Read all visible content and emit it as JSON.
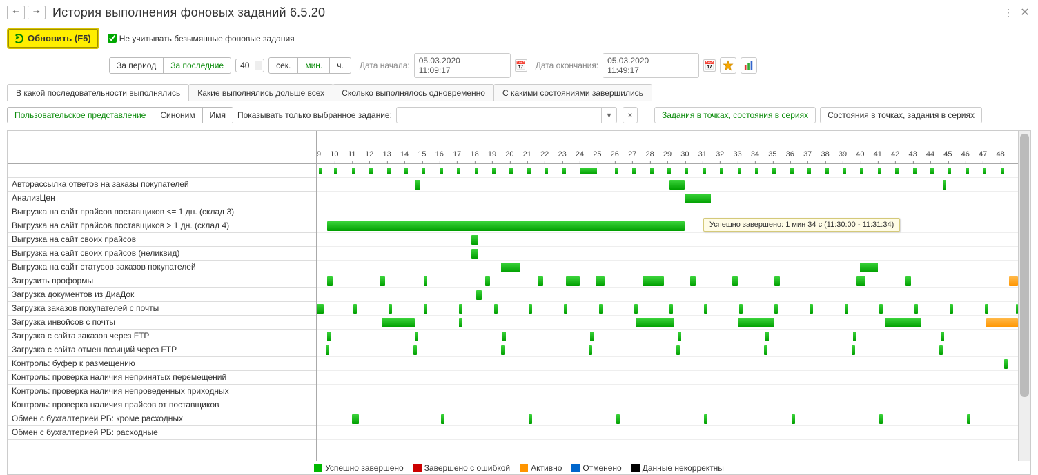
{
  "title": "История выполнения фоновых заданий 6.5.20",
  "toolbar": {
    "refresh_label": "Обновить (F5)",
    "ignore_unnamed_label": "Не учитывать безымянные фоновые задания",
    "period_btn": "За период",
    "last_btn": "За последние",
    "spinner_value": "40",
    "unit_sec": "сек.",
    "unit_min": "мин.",
    "unit_hour": "ч.",
    "date_start_label": "Дата начала:",
    "date_start": "05.03.2020 11:09:17",
    "date_end_label": "Дата окончания:",
    "date_end": "05.03.2020 11:49:17"
  },
  "tabs": [
    "В какой последовательности выполнялись",
    "Какие выполнялись дольше всех",
    "Сколько выполнялось одновременно",
    "С какими состояниями завершились"
  ],
  "subtabs": {
    "user_repr": "Пользовательское представление",
    "synonym": "Синоним",
    "name": "Имя",
    "show_selected_label": "Показывать только выбранное задание:",
    "series1": "Задания в точках, состояния в сериях",
    "series2": "Состояния в точках, задания в сериях"
  },
  "tooltip_text": "Успешно завершено: 1 мин 34 с (11:30:00 - 11:31:34)",
  "legend": {
    "success": "Успешно завершено",
    "err": "Завершено с ошибкой",
    "active": "Активно",
    "cancel": "Отменено",
    "bad": "Данные некорректны"
  },
  "ticks": [
    9,
    10,
    11,
    12,
    13,
    14,
    15,
    16,
    17,
    18,
    19,
    20,
    21,
    22,
    23,
    24,
    25,
    26,
    27,
    28,
    29,
    30,
    31,
    32,
    33,
    34,
    35,
    36,
    37,
    38,
    39,
    40,
    41,
    42,
    43,
    44,
    45,
    46,
    47,
    48
  ],
  "chart_data": {
    "type": "gantt-timeline",
    "x_unit": "minute_index",
    "x_range": [
      9,
      49
    ],
    "rows": [
      {
        "label": "",
        "bars": [
          [
            9.1,
            9.3
          ],
          [
            10.0,
            10.2
          ],
          [
            11.0,
            11.2
          ],
          [
            12.0,
            12.2
          ],
          [
            13.0,
            13.2
          ],
          [
            14.0,
            14.2
          ],
          [
            15.0,
            15.2
          ],
          [
            16.0,
            16.2
          ],
          [
            17.0,
            17.2
          ],
          [
            18.0,
            18.2
          ],
          [
            19.0,
            19.2
          ],
          [
            20.0,
            20.2
          ],
          [
            21.0,
            21.2
          ],
          [
            22.0,
            22.2
          ],
          [
            23.0,
            23.2
          ],
          [
            24.0,
            25.0
          ],
          [
            26.0,
            26.2
          ],
          [
            27.0,
            27.2
          ],
          [
            28.0,
            28.2
          ],
          [
            29.0,
            29.2
          ],
          [
            30.0,
            30.2
          ],
          [
            31.0,
            31.2
          ],
          [
            32.0,
            32.2
          ],
          [
            33.0,
            33.2
          ],
          [
            34.0,
            34.2
          ],
          [
            35.0,
            35.2
          ],
          [
            36.0,
            36.2
          ],
          [
            37.0,
            37.2
          ],
          [
            38.0,
            38.2
          ],
          [
            39.0,
            39.2
          ],
          [
            40.0,
            40.2
          ],
          [
            41.0,
            41.2
          ],
          [
            42.0,
            42.2
          ],
          [
            43.0,
            43.2
          ],
          [
            44.0,
            44.2
          ],
          [
            45.0,
            45.2
          ],
          [
            46.0,
            46.2
          ],
          [
            47.0,
            47.2
          ],
          [
            48.0,
            48.2
          ]
        ]
      },
      {
        "label": "Авторассылка ответов на заказы покупателей",
        "bars": [
          [
            14.6,
            14.9
          ],
          [
            29.1,
            30.0
          ],
          [
            44.7,
            44.9
          ]
        ]
      },
      {
        "label": "АнализЦен",
        "bars": [
          [
            30.0,
            31.5
          ]
        ]
      },
      {
        "label": "Выгрузка на сайт прайсов поставщиков <= 1 дн. (склад 3)",
        "bars": []
      },
      {
        "label": "Выгрузка на сайт прайсов поставщиков > 1 дн. (склад 4)",
        "bars": [
          [
            9.6,
            30.0
          ]
        ]
      },
      {
        "label": "Выгрузка на сайт своих прайсов",
        "bars": [
          [
            17.8,
            18.2
          ]
        ]
      },
      {
        "label": "Выгрузка на сайт своих прайсов (неликвид)",
        "bars": [
          [
            17.8,
            18.2
          ]
        ]
      },
      {
        "label": "Выгрузка на сайт статусов заказов покупателей",
        "bars": [
          [
            19.5,
            20.6
          ],
          [
            40.0,
            41.0
          ]
        ]
      },
      {
        "label": "Загрузить проформы",
        "bars": [
          [
            9.6,
            9.9
          ],
          [
            12.6,
            12.9
          ],
          [
            15.1,
            15.3
          ],
          [
            18.6,
            18.9
          ],
          [
            21.6,
            21.9
          ],
          [
            23.2,
            24.0
          ],
          [
            24.9,
            25.4
          ],
          [
            27.6,
            28.8
          ],
          [
            30.3,
            30.6
          ],
          [
            32.7,
            33.0
          ],
          [
            35.1,
            35.4
          ],
          [
            39.8,
            40.3
          ],
          [
            42.6,
            42.9
          ],
          [
            48.5,
            49.0
          ]
        ]
      },
      {
        "label": "Загрузка документов из ДиаДок",
        "bars": [
          [
            18.1,
            18.4
          ]
        ]
      },
      {
        "label": "Загрузка заказов покупателей с почты",
        "bars": [
          [
            8.9,
            9.4
          ],
          [
            11.1,
            11.3
          ],
          [
            13.1,
            13.3
          ],
          [
            15.1,
            15.3
          ],
          [
            17.1,
            17.3
          ],
          [
            19.1,
            19.3
          ],
          [
            21.1,
            21.3
          ],
          [
            23.1,
            23.3
          ],
          [
            25.1,
            25.3
          ],
          [
            27.1,
            27.3
          ],
          [
            29.1,
            29.3
          ],
          [
            31.1,
            31.3
          ],
          [
            33.1,
            33.3
          ],
          [
            35.1,
            35.3
          ],
          [
            37.1,
            37.3
          ],
          [
            39.1,
            39.3
          ],
          [
            41.1,
            41.3
          ],
          [
            43.1,
            43.3
          ],
          [
            45.1,
            45.3
          ],
          [
            47.1,
            47.3
          ],
          [
            48.9,
            49.0
          ]
        ]
      },
      {
        "label": "Загрузка инвойсов с почты",
        "bars": [
          [
            12.7,
            14.6
          ],
          [
            17.1,
            17.3
          ],
          [
            27.2,
            29.4
          ],
          [
            33.0,
            35.1
          ],
          [
            41.4,
            43.5
          ],
          [
            47.2,
            49.0
          ]
        ]
      },
      {
        "label": "Загрузка с сайта заказов через FTP",
        "bars": [
          [
            9.6,
            9.8
          ],
          [
            14.6,
            14.8
          ],
          [
            19.6,
            19.8
          ],
          [
            24.6,
            24.8
          ],
          [
            29.6,
            29.8
          ],
          [
            34.6,
            34.8
          ],
          [
            39.6,
            39.8
          ],
          [
            44.6,
            44.8
          ]
        ]
      },
      {
        "label": "Загрузка с сайта отмен позиций через FTP",
        "bars": [
          [
            9.5,
            9.7
          ],
          [
            14.5,
            14.7
          ],
          [
            19.5,
            19.7
          ],
          [
            24.5,
            24.7
          ],
          [
            29.5,
            29.7
          ],
          [
            34.5,
            34.7
          ],
          [
            39.5,
            39.7
          ],
          [
            44.5,
            44.7
          ]
        ]
      },
      {
        "label": "Контроль: буфер к размещению",
        "bars": [
          [
            48.2,
            48.4
          ]
        ]
      },
      {
        "label": "Контроль: проверка наличия непринятых перемещений",
        "bars": []
      },
      {
        "label": "Контроль: проверка наличия непроведенных приходных",
        "bars": []
      },
      {
        "label": "Контроль: проверка наличия прайсов от поставщиков",
        "bars": []
      },
      {
        "label": "Обмен с бухгалтерией РБ: кроме расходных",
        "bars": [
          [
            11.0,
            11.4
          ],
          [
            16.1,
            16.3
          ],
          [
            21.1,
            21.3
          ],
          [
            26.1,
            26.3
          ],
          [
            31.1,
            31.3
          ],
          [
            36.1,
            36.3
          ],
          [
            41.1,
            41.3
          ],
          [
            46.1,
            46.3
          ]
        ]
      },
      {
        "label": "Обмен с бухгалтерией РБ: расходные",
        "bars": []
      }
    ],
    "active_bars": [
      {
        "row": 8,
        "span": [
          48.5,
          49.0
        ]
      },
      {
        "row": 11,
        "span": [
          47.2,
          49.0
        ]
      }
    ]
  }
}
